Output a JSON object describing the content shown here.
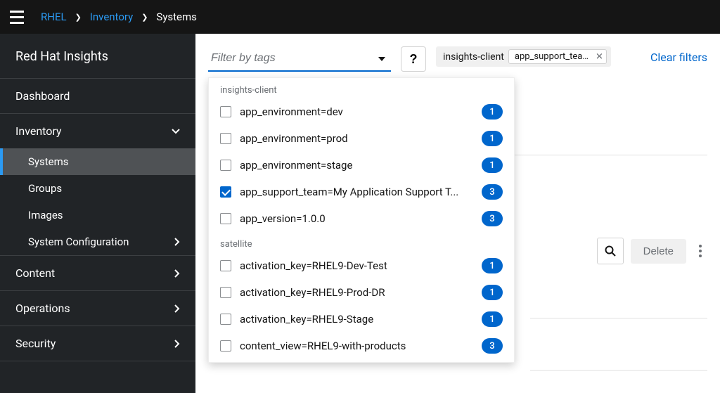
{
  "breadcrumbs": {
    "root": "RHEL",
    "mid": "Inventory",
    "current": "Systems"
  },
  "brand": "Red Hat Insights",
  "sidebar": {
    "dashboard": "Dashboard",
    "inventory": "Inventory",
    "inventory_items": {
      "systems": "Systems",
      "groups": "Groups",
      "images": "Images",
      "syscfg": "System Configuration"
    },
    "content": "Content",
    "operations": "Operations",
    "security": "Security"
  },
  "filter": {
    "placeholder": "Filter by tags",
    "help_aria": "Help",
    "clear": "Clear filters"
  },
  "selected_chip": {
    "group_label": "insights-client",
    "chip_text": "app_support_team=M..."
  },
  "dropdown": {
    "groups": [
      {
        "label": "insights-client",
        "items": [
          {
            "label": "app_environment=dev",
            "count": 1,
            "checked": false
          },
          {
            "label": "app_environment=prod",
            "count": 1,
            "checked": false
          },
          {
            "label": "app_environment=stage",
            "count": 1,
            "checked": false
          },
          {
            "label": "app_support_team=My Application Support T...",
            "count": 3,
            "checked": true
          },
          {
            "label": "app_version=1.0.0",
            "count": 3,
            "checked": false
          }
        ]
      },
      {
        "label": "satellite",
        "items": [
          {
            "label": "activation_key=RHEL9-Dev-Test",
            "count": 1,
            "checked": false
          },
          {
            "label": "activation_key=RHEL9-Prod-DR",
            "count": 1,
            "checked": false
          },
          {
            "label": "activation_key=RHEL9-Stage",
            "count": 1,
            "checked": false
          },
          {
            "label": "content_view=RHEL9-with-products",
            "count": 3,
            "checked": false
          }
        ]
      }
    ]
  },
  "toolbar": {
    "delete": "Delete"
  }
}
